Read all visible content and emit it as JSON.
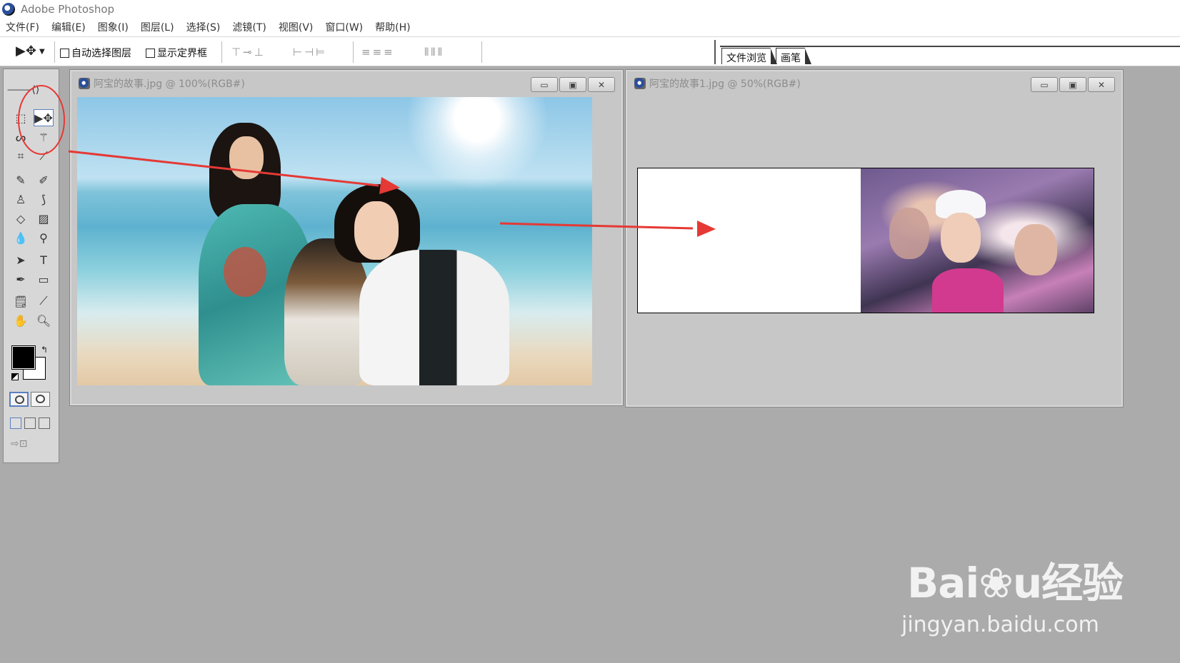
{
  "app": {
    "title": "Adobe Photoshop"
  },
  "menu": [
    "文件(F)",
    "编辑(E)",
    "图象(I)",
    "图层(L)",
    "选择(S)",
    "滤镜(T)",
    "视图(V)",
    "窗口(W)",
    "帮助(H)"
  ],
  "options_bar": {
    "auto_select_label": "自动选择图层",
    "auto_select_checked": false,
    "show_bounds_label": "显示定界框",
    "show_bounds_checked": false,
    "align_icons_group1": "⊤⊸⊥",
    "align_icons_group2": "⊢⊣⊨",
    "distribute_icons_group1": "≡≡≡",
    "distribute_icons_group2": "⫴⫴⫴"
  },
  "palette_well": {
    "tabs": [
      "文件浏览",
      "画笔"
    ]
  },
  "toolbox": {
    "foreground_color": "#000000",
    "background_color": "#ffffff",
    "active_tool": "move-tool",
    "jump_label": "⇨⊡"
  },
  "documents": [
    {
      "title": "阿宝的故事.jpg @ 100%(RGB#)",
      "buttons": [
        "▭",
        "▣",
        "✕"
      ]
    },
    {
      "title": "阿宝的故事1.jpg @ 50%(RGB#)",
      "buttons": [
        "▭",
        "▣",
        "✕"
      ]
    }
  ],
  "annotation_color": "#e53935",
  "watermark": {
    "logo": "Bai❀u经验",
    "sub": "jingyan.baidu.com"
  }
}
